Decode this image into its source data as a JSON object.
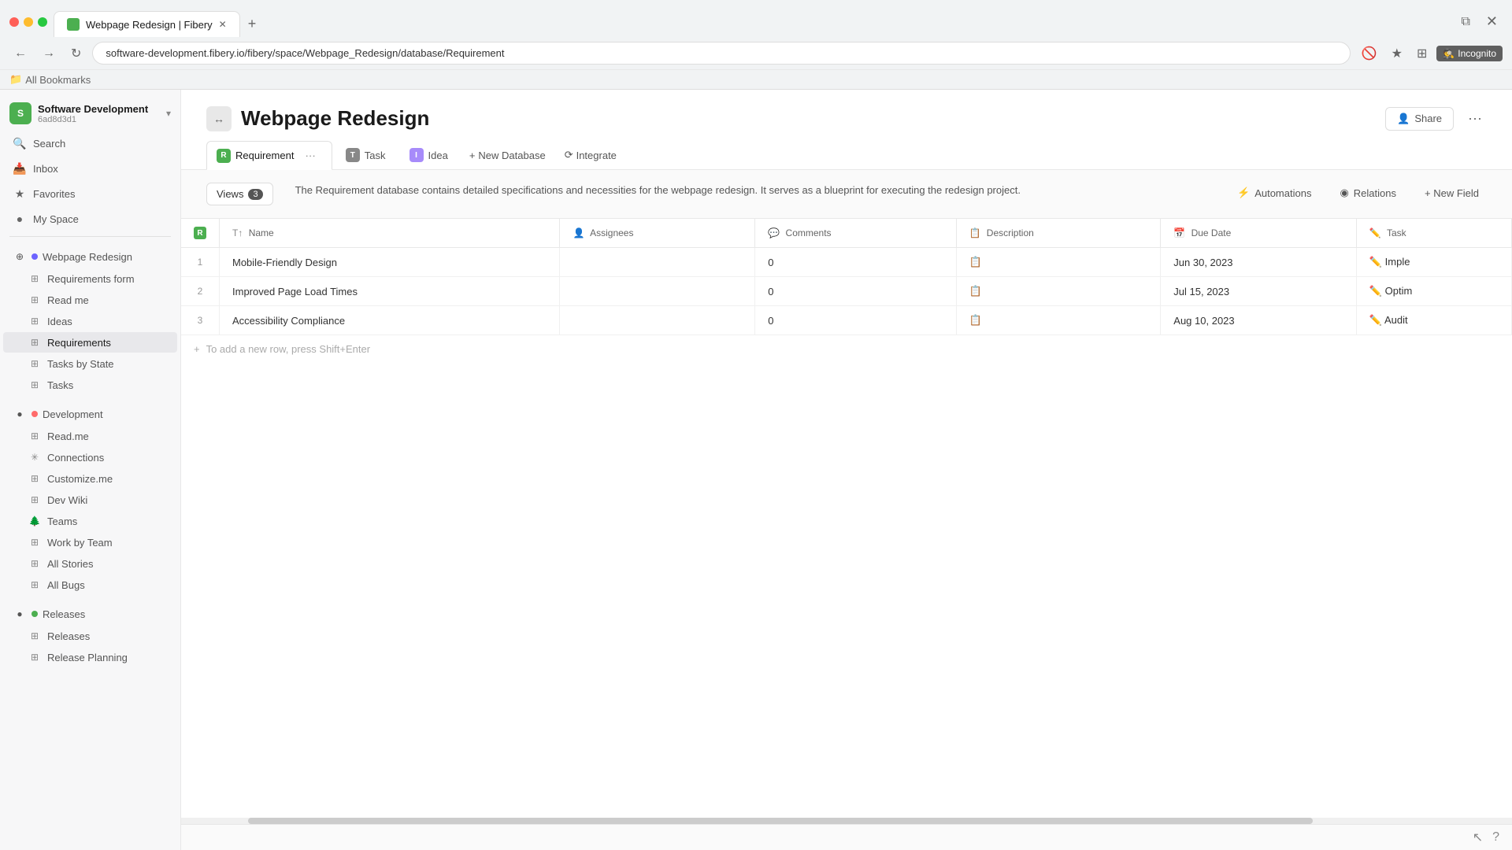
{
  "browser": {
    "tab_title": "Webpage Redesign | Fibery",
    "url": "software-development.fibery.io/fibery/space/Webpage_Redesign/database/Requirement",
    "incognito_label": "Incognito",
    "bookmarks_label": "All Bookmarks"
  },
  "sidebar": {
    "workspace": {
      "name": "Software Development",
      "id": "6ad8d3d1"
    },
    "search_label": "Search",
    "inbox_label": "Inbox",
    "favorites_label": "Favorites",
    "my_space_label": "My Space",
    "sections": [
      {
        "name": "Webpage Redesign",
        "color": "#6c63ff",
        "items": [
          {
            "label": "Requirements form",
            "icon": "grid"
          },
          {
            "label": "Read me",
            "icon": "grid"
          },
          {
            "label": "Ideas",
            "icon": "grid"
          },
          {
            "label": "Requirements",
            "icon": "grid"
          },
          {
            "label": "Tasks by State",
            "icon": "grid"
          },
          {
            "label": "Tasks",
            "icon": "grid"
          }
        ]
      },
      {
        "name": "Development",
        "color": "#ff6b6b",
        "items": [
          {
            "label": "Read.me",
            "icon": "grid"
          },
          {
            "label": "Connections",
            "icon": "asterisk"
          },
          {
            "label": "Customize.me",
            "icon": "grid"
          },
          {
            "label": "Dev Wiki",
            "icon": "grid"
          },
          {
            "label": "Teams",
            "icon": "tree"
          },
          {
            "label": "Work by Team",
            "icon": "grid"
          },
          {
            "label": "All Stories",
            "icon": "grid"
          },
          {
            "label": "All Bugs",
            "icon": "grid"
          }
        ]
      },
      {
        "name": "Releases",
        "color": "#4CAF50",
        "items": [
          {
            "label": "Releases",
            "icon": "grid"
          },
          {
            "label": "Release Planning",
            "icon": "grid"
          }
        ]
      }
    ]
  },
  "page": {
    "title": "Webpage Redesign",
    "share_label": "Share",
    "tabs": [
      {
        "label": "Requirement",
        "color": "#4CAF50",
        "active": true
      },
      {
        "label": "Task",
        "color": "#888"
      },
      {
        "label": "Idea",
        "color": "#a78bfa"
      }
    ],
    "new_database_label": "+ New Database",
    "integrate_label": "Integrate",
    "views_label": "Views",
    "views_count": "3",
    "description": "The Requirement database contains detailed specifications and necessities for the webpage redesign. It serves as a blueprint for executing the redesign project.",
    "automations_label": "Automations",
    "relations_label": "Relations",
    "new_field_label": "+ New Field"
  },
  "table": {
    "columns": [
      {
        "label": "#"
      },
      {
        "label": "Name",
        "icon": "T↑"
      },
      {
        "label": "Assignees",
        "icon": "👤"
      },
      {
        "label": "Comments",
        "icon": "💬"
      },
      {
        "label": "Description",
        "icon": "📄"
      },
      {
        "label": "Due Date",
        "icon": "📅"
      },
      {
        "label": "Task",
        "icon": "✏️"
      }
    ],
    "rows": [
      {
        "num": 1,
        "name": "Mobile-Friendly Design",
        "assignees": "",
        "comments": "0",
        "description": "📋",
        "due_date": "Jun 30, 2023",
        "task": "✏️ Imple"
      },
      {
        "num": 2,
        "name": "Improved Page Load Times",
        "assignees": "",
        "comments": "0",
        "description": "📋",
        "due_date": "Jul 15, 2023",
        "task": "✏️ Optim"
      },
      {
        "num": 3,
        "name": "Accessibility Compliance",
        "assignees": "",
        "comments": "0",
        "description": "📋",
        "due_date": "Aug 10, 2023",
        "task": "✏️ Audit"
      }
    ],
    "add_row_hint": "To add a new row, press Shift+Enter"
  }
}
